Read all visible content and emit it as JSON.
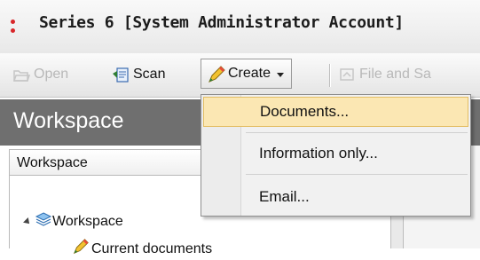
{
  "window": {
    "title": "Series 6 [System Administrator Account]"
  },
  "toolbar": {
    "open_label": "Open",
    "scan_label": "Scan",
    "create_label": "Create",
    "file_label": "File and Sa"
  },
  "menu": {
    "items": [
      {
        "label": "Documents...",
        "highlighted": true
      },
      {
        "label": "Information only..."
      },
      {
        "label": "Email..."
      }
    ]
  },
  "workspace": {
    "header": "Workspace",
    "column_header": "Workspace",
    "tree": [
      {
        "label": "Workspace",
        "icon": "workspace-stack-icon",
        "expanded": true
      },
      {
        "label": "Current documents",
        "icon": "pencil-icon"
      }
    ]
  },
  "colors": {
    "panel_header": "#6f6f6f",
    "menu_highlight": "#fbe7b3",
    "menu_highlight_border": "#e3bd63",
    "app_icon": "#d8262a"
  }
}
